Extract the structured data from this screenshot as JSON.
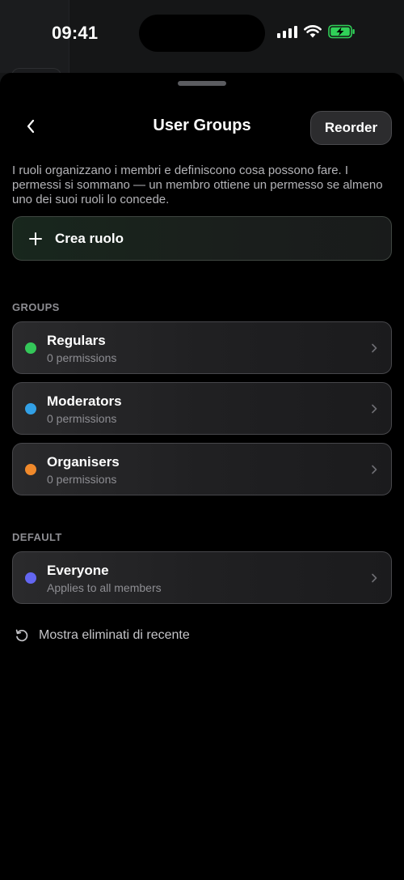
{
  "status": {
    "time": "09:41"
  },
  "nav": {
    "title": "User Groups",
    "reorder_label": "Reorder"
  },
  "intro": "I ruoli organizzano i membri e definiscono cosa possono fare. I permessi si sommano — un membro ottiene un permesso se almeno uno dei suoi ruoli lo concede.",
  "create": {
    "label": "Crea ruolo"
  },
  "groups": {
    "label": "GROUPS",
    "items": [
      {
        "name": "Regulars",
        "subtitle": "0 permissions",
        "color": "#34c759"
      },
      {
        "name": "Moderators",
        "subtitle": "0 permissions",
        "color": "#32a0e6"
      },
      {
        "name": "Organisers",
        "subtitle": "0 permissions",
        "color": "#f0892b"
      }
    ]
  },
  "default": {
    "label": "DEFAULT",
    "items": [
      {
        "name": "Everyone",
        "subtitle": "Applies to all members",
        "color": "#6366f1"
      }
    ]
  },
  "recent": {
    "label": "Mostra eliminati di recente"
  },
  "colors": {
    "battery": "#30d158",
    "background": "#000000"
  },
  "icons": [
    "back-chevron-icon",
    "plus-icon",
    "chevron-right-icon",
    "restore-icon",
    "wifi-icon",
    "signal-icon",
    "battery-charging-icon"
  ]
}
